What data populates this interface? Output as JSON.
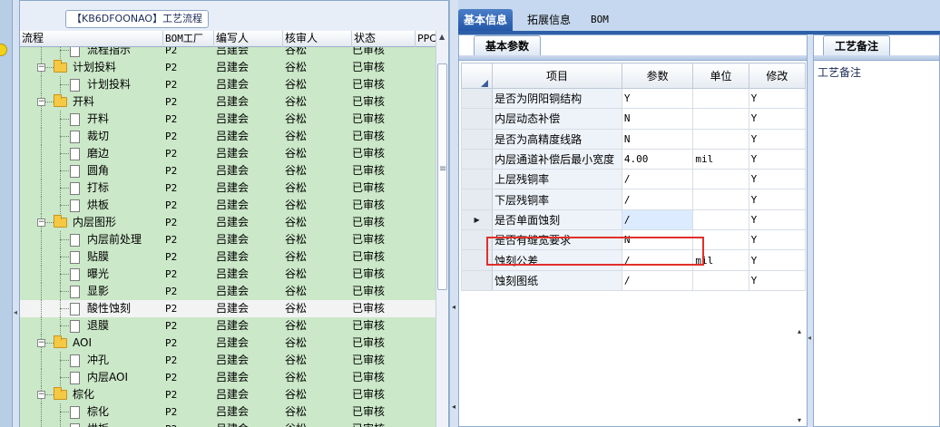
{
  "tree_panel": {
    "caption": "【KB6DFOONAO】工艺流程",
    "columns": [
      "流程",
      "BOM工厂",
      "编写人",
      "核审人",
      "状态",
      "PPC"
    ],
    "rows": [
      {
        "label": "流程指示",
        "level": 2,
        "type": "doc",
        "bom": "P2",
        "writer": "吕建会",
        "reviewer": "谷松",
        "status": "已审核"
      },
      {
        "label": "计划投料",
        "level": 1,
        "type": "folder",
        "bom": "P2",
        "writer": "吕建会",
        "reviewer": "谷松",
        "status": "已审核"
      },
      {
        "label": "计划投料",
        "level": 2,
        "type": "doc",
        "bom": "P2",
        "writer": "吕建会",
        "reviewer": "谷松",
        "status": "已审核"
      },
      {
        "label": "开料",
        "level": 1,
        "type": "folder",
        "bom": "P2",
        "writer": "吕建会",
        "reviewer": "谷松",
        "status": "已审核"
      },
      {
        "label": "开料",
        "level": 2,
        "type": "doc",
        "bom": "P2",
        "writer": "吕建会",
        "reviewer": "谷松",
        "status": "已审核"
      },
      {
        "label": "裁切",
        "level": 2,
        "type": "doc",
        "bom": "P2",
        "writer": "吕建会",
        "reviewer": "谷松",
        "status": "已审核"
      },
      {
        "label": "磨边",
        "level": 2,
        "type": "doc",
        "bom": "P2",
        "writer": "吕建会",
        "reviewer": "谷松",
        "status": "已审核"
      },
      {
        "label": "圆角",
        "level": 2,
        "type": "doc",
        "bom": "P2",
        "writer": "吕建会",
        "reviewer": "谷松",
        "status": "已审核"
      },
      {
        "label": "打标",
        "level": 2,
        "type": "doc",
        "bom": "P2",
        "writer": "吕建会",
        "reviewer": "谷松",
        "status": "已审核"
      },
      {
        "label": "烘板",
        "level": 2,
        "type": "doc",
        "bom": "P2",
        "writer": "吕建会",
        "reviewer": "谷松",
        "status": "已审核"
      },
      {
        "label": "内层图形",
        "level": 1,
        "type": "folder",
        "bom": "P2",
        "writer": "吕建会",
        "reviewer": "谷松",
        "status": "已审核"
      },
      {
        "label": "内层前处理",
        "level": 2,
        "type": "doc",
        "bom": "P2",
        "writer": "吕建会",
        "reviewer": "谷松",
        "status": "已审核"
      },
      {
        "label": "贴膜",
        "level": 2,
        "type": "doc",
        "bom": "P2",
        "writer": "吕建会",
        "reviewer": "谷松",
        "status": "已审核"
      },
      {
        "label": "曝光",
        "level": 2,
        "type": "doc",
        "bom": "P2",
        "writer": "吕建会",
        "reviewer": "谷松",
        "status": "已审核"
      },
      {
        "label": "显影",
        "level": 2,
        "type": "doc",
        "bom": "P2",
        "writer": "吕建会",
        "reviewer": "谷松",
        "status": "已审核"
      },
      {
        "label": "酸性蚀刻",
        "level": 2,
        "type": "doc",
        "bom": "P2",
        "writer": "吕建会",
        "reviewer": "谷松",
        "status": "已审核",
        "selected": true
      },
      {
        "label": "退膜",
        "level": 2,
        "type": "doc",
        "bom": "P2",
        "writer": "吕建会",
        "reviewer": "谷松",
        "status": "已审核"
      },
      {
        "label": "AOI",
        "level": 1,
        "type": "folder",
        "bom": "P2",
        "writer": "吕建会",
        "reviewer": "谷松",
        "status": "已审核"
      },
      {
        "label": "冲孔",
        "level": 2,
        "type": "doc",
        "bom": "P2",
        "writer": "吕建会",
        "reviewer": "谷松",
        "status": "已审核"
      },
      {
        "label": "内层AOI",
        "level": 2,
        "type": "doc",
        "bom": "P2",
        "writer": "吕建会",
        "reviewer": "谷松",
        "status": "已审核"
      },
      {
        "label": "棕化",
        "level": 1,
        "type": "folder",
        "bom": "P2",
        "writer": "吕建会",
        "reviewer": "谷松",
        "status": "已审核"
      },
      {
        "label": "棕化",
        "level": 2,
        "type": "doc",
        "bom": "P2",
        "writer": "吕建会",
        "reviewer": "谷松",
        "status": "已审核"
      },
      {
        "label": "烘板",
        "level": 2,
        "type": "doc",
        "bom": "P2",
        "writer": "吕建会",
        "reviewer": "谷松",
        "status": "已审核"
      }
    ]
  },
  "top_tabs": [
    "基本信息",
    "拓展信息",
    "BOM"
  ],
  "params": {
    "subtab": "基本参数",
    "columns": [
      "项目",
      "参数",
      "单位",
      "修改"
    ],
    "rows": [
      {
        "item": "是否为阴阳铜结构",
        "value": "Y",
        "unit": "",
        "modify": "Y"
      },
      {
        "item": "内层动态补偿",
        "value": "N",
        "unit": "",
        "modify": "Y"
      },
      {
        "item": "是否为高精度线路",
        "value": "N",
        "unit": "",
        "modify": "Y"
      },
      {
        "item": "内层通道补偿后最小宽度",
        "value": "4.00",
        "unit": "mil",
        "modify": "Y"
      },
      {
        "item": "上层残铜率",
        "value": "/",
        "unit": "",
        "modify": "Y"
      },
      {
        "item": "下层残铜率",
        "value": "/",
        "unit": "",
        "modify": "Y"
      },
      {
        "item": "是否单面蚀刻",
        "value": "/",
        "unit": "",
        "modify": "Y",
        "current": true
      },
      {
        "item": "是否有缝宽要求",
        "value": "N",
        "unit": "",
        "modify": "Y"
      },
      {
        "item": "蚀刻公差",
        "value": "/",
        "unit": "mil",
        "modify": "Y"
      },
      {
        "item": "蚀刻图纸",
        "value": "/",
        "unit": "",
        "modify": "Y"
      }
    ]
  },
  "notes": {
    "subtab": "工艺备注",
    "label": "工艺备注"
  }
}
